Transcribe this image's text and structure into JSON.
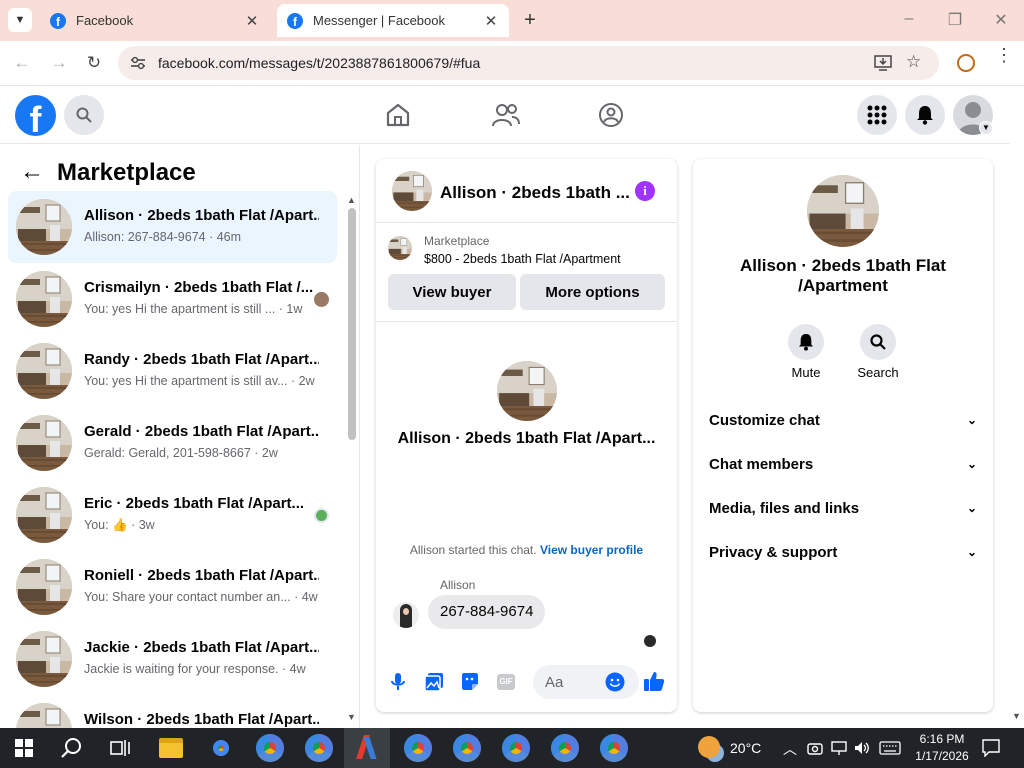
{
  "browser": {
    "tabs": [
      {
        "title": "Facebook"
      },
      {
        "title": "Messenger | Facebook"
      }
    ],
    "url": "facebook.com/messages/t/2023887861800679/#fua"
  },
  "left_panel": {
    "title": "Marketplace",
    "conversations": [
      {
        "name": "Allison · 2beds 1bath Flat /Apart...",
        "preview": "Allison: 267-884-9674 · 46m",
        "active": true
      },
      {
        "name": "Crismailyn · 2beds 1bath Flat /...",
        "preview": "You: yes Hi the apartment is still ... · 1w"
      },
      {
        "name": "Randy · 2beds 1bath Flat /Apart...",
        "preview": "You: yes Hi the apartment is still av... · 2w"
      },
      {
        "name": "Gerald · 2beds 1bath Flat /Apart...",
        "preview": "Gerald: Gerald, 201-598-8667 · 2w"
      },
      {
        "name": "Eric · 2beds 1bath Flat /Apart...",
        "preview": "You: 👍 · 3w"
      },
      {
        "name": "Roniell · 2beds 1bath Flat /Apart...",
        "preview": "You: Share your contact number an... · 4w"
      },
      {
        "name": "Jackie · 2beds 1bath Flat /Apart...",
        "preview": "Jackie is waiting for your response. · 4w"
      },
      {
        "name": "Wilson · 2beds 1bath Flat /Apart...",
        "preview": ""
      }
    ]
  },
  "chat": {
    "header_title": "Allison · 2beds 1bath ...",
    "listing_label": "Marketplace",
    "listing_text": "$800 - 2beds 1bath Flat /Apartment",
    "view_buyer": "View buyer",
    "more_options": "More options",
    "profile_name": "Allison · 2beds 1bath Flat /Apart...",
    "started_text": "Allison started this chat.",
    "view_profile_link": "View buyer profile",
    "sender": "Allison",
    "message": "267-884-9674",
    "input_placeholder": "Aa"
  },
  "info": {
    "name": "Allison · 2beds 1bath Flat /Apartment",
    "mute_label": "Mute",
    "search_label": "Search",
    "sections": [
      {
        "label": "Customize chat"
      },
      {
        "label": "Chat members"
      },
      {
        "label": "Media, files and links"
      },
      {
        "label": "Privacy & support"
      }
    ]
  },
  "taskbar": {
    "weather": "20°C",
    "time": "6:16 PM",
    "date": "1/17/2026"
  },
  "colors": {
    "fb_blue": "#1877f2",
    "messenger_purple": "#a033ff",
    "tab_strip": "#f8ded6",
    "taskbar": "#202428"
  }
}
